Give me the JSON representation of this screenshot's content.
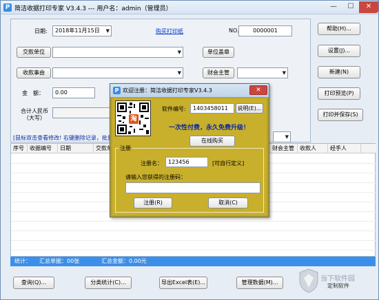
{
  "window": {
    "title": "简洁收据打印专家 V3.4.3 --- 用户名：admin（管理员）",
    "controls": [
      "—",
      "☐",
      "✕"
    ]
  },
  "form": {
    "date_label": "日期:",
    "date_value": "2018年11月15日",
    "buy_paper_link": "购买打印纸",
    "no_label": "NO.",
    "no_value": "0000001",
    "payer_button": "交款单位",
    "reason_button": "收款事由",
    "amount_label": "金　额：",
    "amount_value": "0.00",
    "total_rmb_label": "合计人民币",
    "total_rmb_label2": "（大写）",
    "unit_stamp_button": "单位盖章",
    "finance_head_button": "财会主管",
    "hint_text": "[鼠标双击查看修改! 右键删除记录，批量"
  },
  "right_buttons": {
    "help": "帮助(H)...",
    "settings": "设置(J)...",
    "new": "新建(N)",
    "preview": "打印预览(P)",
    "print_save": "打印并保存(S)"
  },
  "grid": {
    "columns": [
      "序号",
      "收据编号",
      "日期",
      "交款单",
      "财会主管",
      "收款人",
      "经手人"
    ]
  },
  "status_bar": {
    "label": "统计：",
    "count_text": "汇总单据：00张",
    "sum_text": "汇总金额：0.00元"
  },
  "bottom_buttons": {
    "query": "查询(Q)...",
    "classify": "分类统计(C)...",
    "export": "导出Excel表(E)...",
    "manage": "管理数据(M)..."
  },
  "dialog": {
    "title": "欢迎注册：简洁收据打印专家V3.4.3",
    "serial_label": "软件编号:",
    "serial_value": "1403458011",
    "explain_button": "说明(E)...",
    "slogan": "一次性付费，永久免费升级！",
    "buy_online_button": "在线购买",
    "group_title": "注册",
    "reg_name_label": "注册名：",
    "reg_name_value": "123456",
    "reg_name_hint": "[可自行定义]",
    "reg_code_label": "请输入您获得的注册码：",
    "reg_code_value": "",
    "register_button": "注册(R)",
    "cancel_button": "取消(C)",
    "qr_badge": "淘"
  },
  "watermark": {
    "text1": "当下软件园",
    "text2": "定制软件"
  }
}
